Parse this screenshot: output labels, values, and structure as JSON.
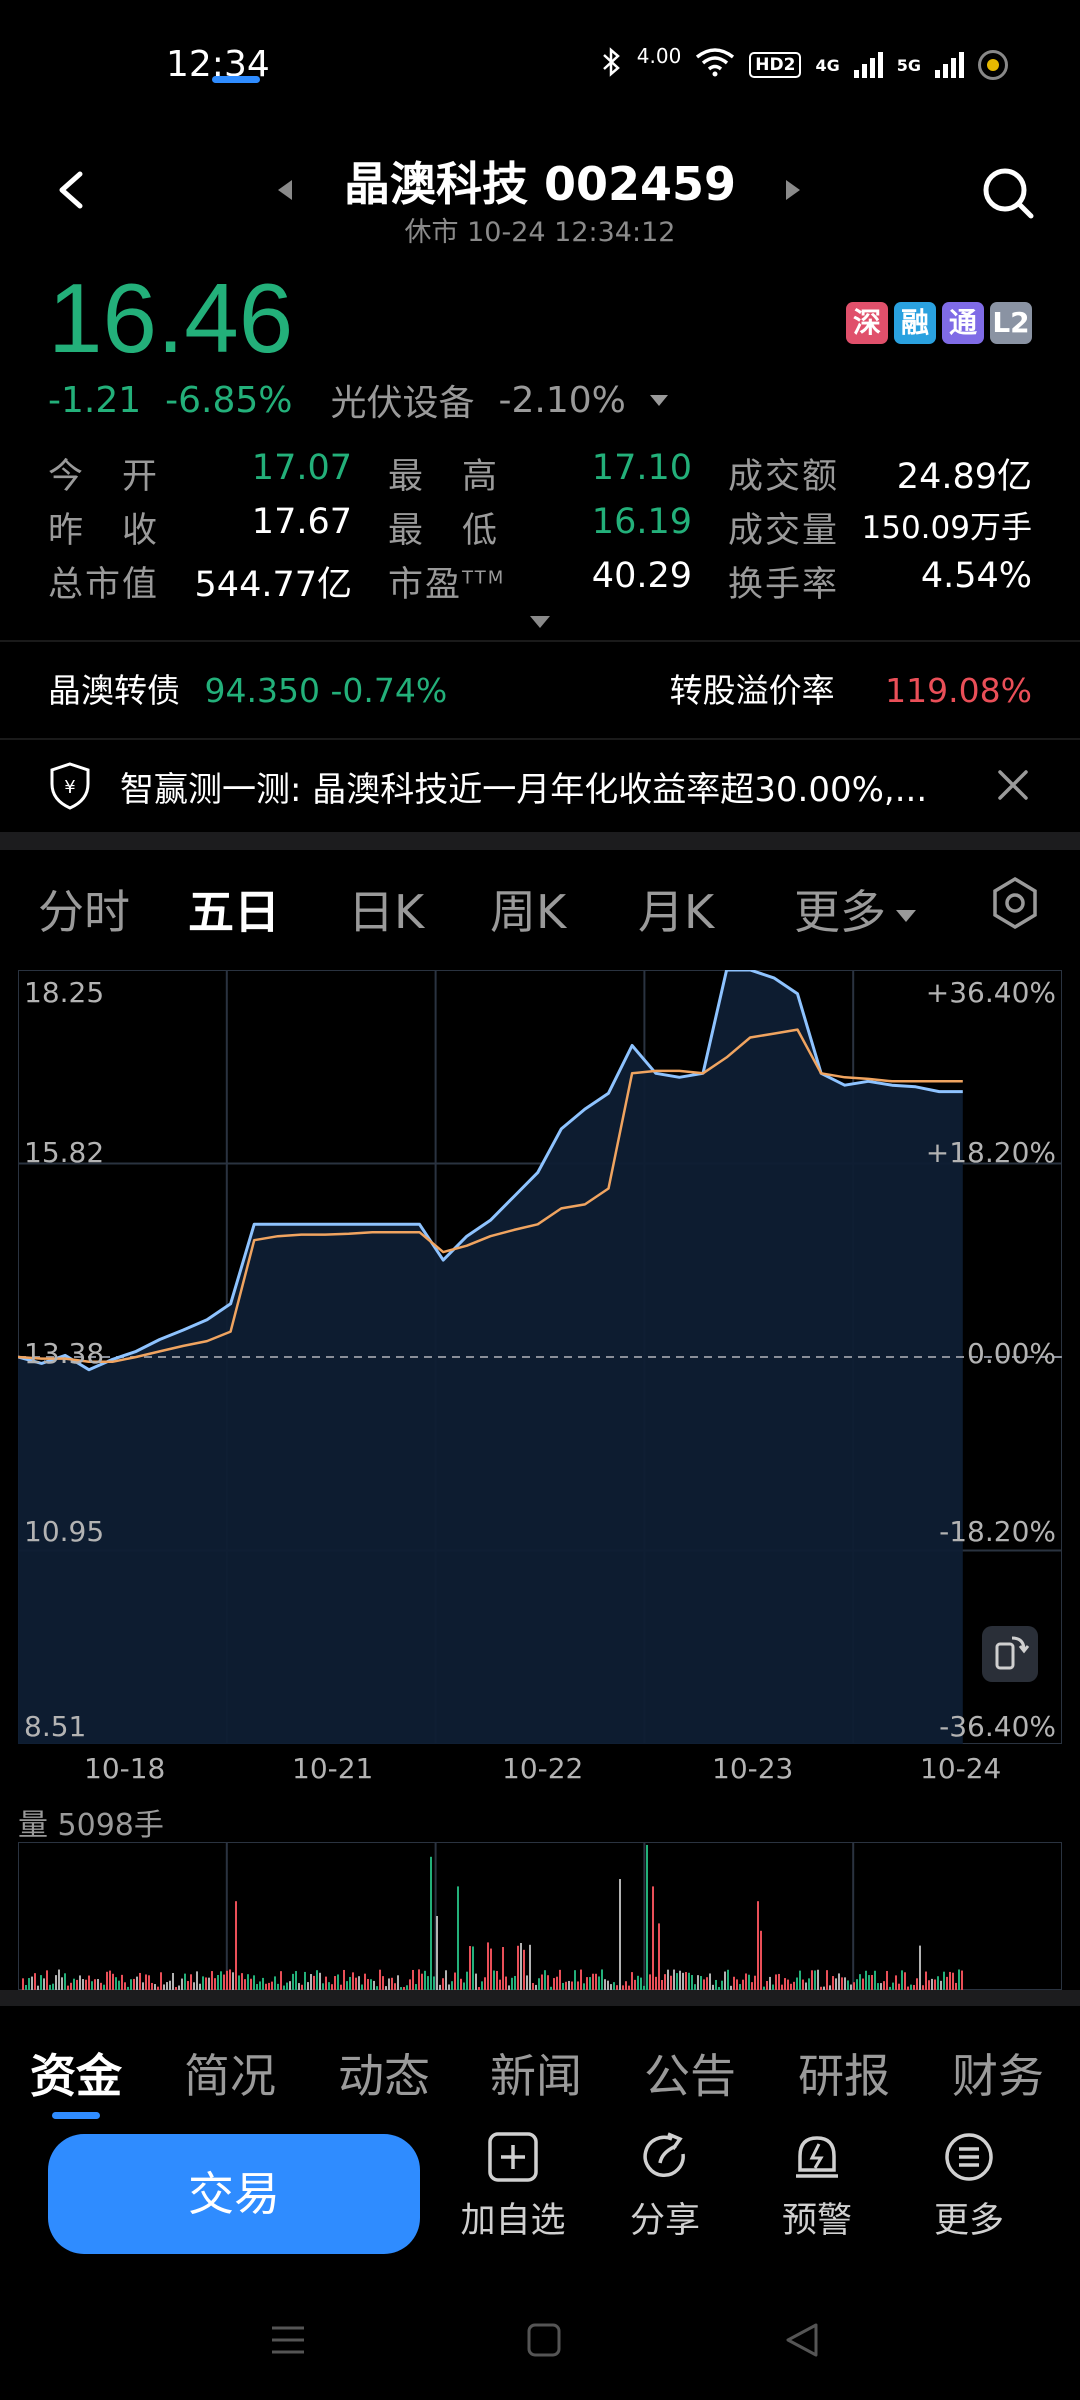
{
  "status_bar": {
    "time": "12:34",
    "net_speed": "4.00",
    "hd_label": "HD2",
    "net1": "4G",
    "net2": "5G"
  },
  "header": {
    "title": "晶澳科技 002459",
    "subtitle": "休市 10-24 12:34:12"
  },
  "quote": {
    "price": "16.46",
    "change": "-1.21",
    "change_pct": "-6.85%",
    "sector": "光伏设备",
    "sector_pct": "-2.10%",
    "badges": [
      {
        "label": "深",
        "color": "#e0506b"
      },
      {
        "label": "融",
        "color": "#2aa1df"
      },
      {
        "label": "通",
        "color": "#7f6be6"
      },
      {
        "label": "L2",
        "color": "#8a93a3"
      }
    ]
  },
  "stats": {
    "rows": [
      [
        {
          "label": "今　开",
          "value": "17.07",
          "tone": "green"
        },
        {
          "label": "最　高",
          "value": "17.10",
          "tone": "green"
        },
        {
          "label": "成交额",
          "value": "24.89亿",
          "tone": "white"
        }
      ],
      [
        {
          "label": "昨　收",
          "value": "17.67",
          "tone": "white"
        },
        {
          "label": "最　低",
          "value": "16.19",
          "tone": "green"
        },
        {
          "label": "成交量",
          "value": "150.09万手",
          "tone": "white"
        }
      ],
      [
        {
          "label": "总市值",
          "value": "544.77亿",
          "tone": "white"
        },
        {
          "label": "市盈TTM",
          "value": "40.29",
          "tone": "white"
        },
        {
          "label": "换手率",
          "value": "4.54%",
          "tone": "white"
        }
      ]
    ]
  },
  "bond": {
    "name": "晶澳转债",
    "price_change": "94.350 -0.74%",
    "premium_label": "转股溢价率",
    "premium_value": "119.08%"
  },
  "notice": {
    "text": "智赢测一测: 晶澳科技近一月年化收益率超30.00%,..."
  },
  "chart_tabs": {
    "items": [
      "分时",
      "五日",
      "日K",
      "周K",
      "月K",
      "更多"
    ],
    "active": "五日"
  },
  "chart_data": {
    "type": "line",
    "title": "",
    "x_categories": [
      "10-18",
      "10-21",
      "10-22",
      "10-23",
      "10-24"
    ],
    "y_ticks_left": [
      "18.25",
      "15.82",
      "13.38",
      "10.95",
      "8.51"
    ],
    "y_ticks_right": [
      "+36.40%",
      "+18.20%",
      "0.00%",
      "-18.20%",
      "-36.40%"
    ],
    "ylim": [
      8.51,
      18.25
    ],
    "reference": 13.38,
    "series": [
      {
        "name": "",
        "color": "#8ec3ff",
        "values": [
          13.38,
          13.3,
          13.4,
          13.22,
          13.35,
          13.45,
          13.6,
          13.72,
          13.85,
          14.05,
          15.05,
          15.05,
          15.05,
          15.05,
          15.05,
          15.05,
          15.05,
          15.05,
          14.6,
          14.9,
          15.1,
          15.4,
          15.7,
          16.25,
          16.5,
          16.7,
          17.3,
          16.95,
          16.9,
          16.95,
          18.25,
          18.25,
          18.15,
          17.95,
          16.95,
          16.8,
          16.85,
          16.8,
          16.78,
          16.72,
          16.72
        ]
      },
      {
        "name": "",
        "color": "#f0a460",
        "values": [
          13.38,
          13.36,
          13.36,
          13.32,
          13.32,
          13.38,
          13.45,
          13.52,
          13.58,
          13.7,
          14.85,
          14.9,
          14.92,
          14.92,
          14.93,
          14.95,
          14.95,
          14.95,
          14.7,
          14.78,
          14.9,
          14.98,
          15.05,
          15.25,
          15.3,
          15.5,
          16.95,
          16.98,
          16.98,
          16.95,
          17.15,
          17.4,
          17.45,
          17.5,
          16.95,
          16.9,
          16.88,
          16.85,
          16.85,
          16.85,
          16.85
        ]
      }
    ],
    "grid": true
  },
  "volume": {
    "label": "量 5098手"
  },
  "bottom_tabs": {
    "items": [
      "资金",
      "简况",
      "动态",
      "新闻",
      "公告",
      "研报",
      "财务"
    ],
    "active": "资金"
  },
  "actions": {
    "trade": "交易",
    "watchlist": "加自选",
    "share": "分享",
    "alert": "预警",
    "more": "更多"
  }
}
